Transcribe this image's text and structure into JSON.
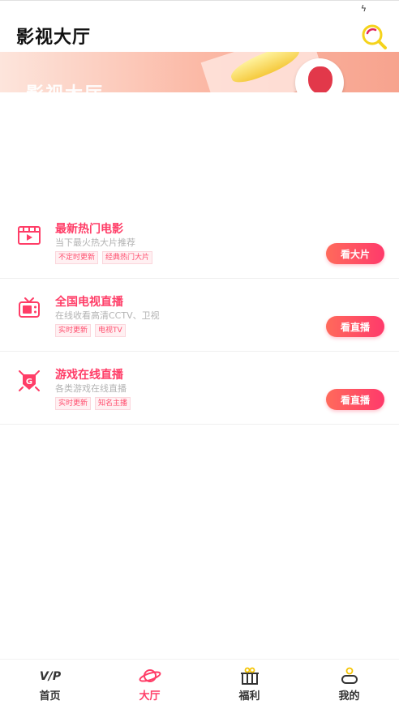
{
  "status_bar": {
    "icon": "lightning-icon"
  },
  "header": {
    "title": "影视大厅",
    "search_icon": "search-icon"
  },
  "banner": {
    "text": "影视大厅"
  },
  "items": [
    {
      "name": "最新热门电影",
      "desc": "当下最火热大片推荐",
      "tags": [
        "不定时更新",
        "经典热门大片"
      ],
      "button": "看大片",
      "icon": "movie-icon"
    },
    {
      "name": "全国电视直播",
      "desc": "在线收看高清CCTV、卫视",
      "tags": [
        "实时更新",
        "电视TV"
      ],
      "button": "看直播",
      "icon": "tv-icon"
    },
    {
      "name": "游戏在线直播",
      "desc": "各类游戏在线直播",
      "tags": [
        "实时更新",
        "知名主播"
      ],
      "button": "看直播",
      "icon": "game-icon"
    }
  ],
  "tabs": [
    {
      "label": "首页",
      "icon": "vip-icon",
      "active": false
    },
    {
      "label": "大厅",
      "icon": "planet-icon",
      "active": true
    },
    {
      "label": "福利",
      "icon": "gift-icon",
      "active": false
    },
    {
      "label": "我的",
      "icon": "user-icon",
      "active": false
    }
  ],
  "colors": {
    "accent": "#ff3d67",
    "button_gradient_start": "#ff6a5b",
    "button_gradient_end": "#ff3a6b",
    "search_yellow": "#f5d31b"
  }
}
